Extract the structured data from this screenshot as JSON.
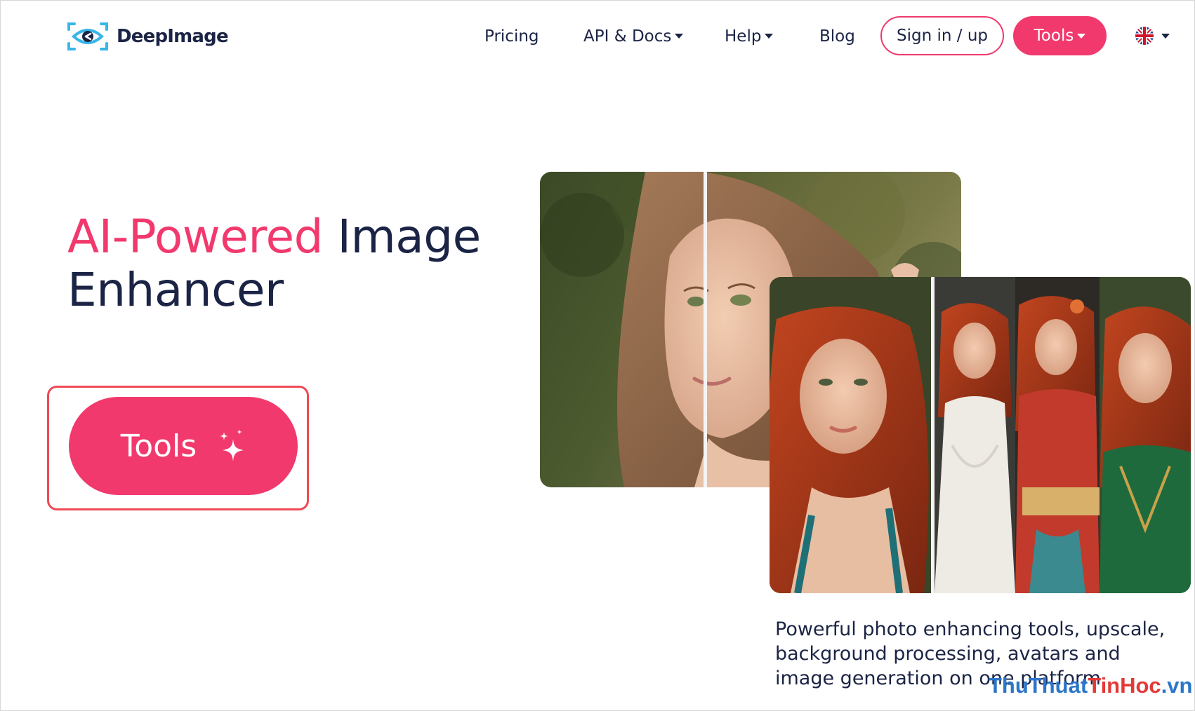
{
  "brand": {
    "name": "DeepImage",
    "colors": {
      "accent": "#f1396d",
      "logo_blue": "#38b6e8",
      "text": "#1b2445"
    }
  },
  "nav": {
    "pricing": "Pricing",
    "api_docs": "API & Docs",
    "help": "Help",
    "blog": "Blog",
    "sign_in": "Sign in / up",
    "tools": "Tools",
    "language_icon": "uk-flag-icon"
  },
  "hero": {
    "title_accent": "AI-Powered",
    "title_rest": "Image",
    "title_line2": "Enhancer",
    "tools_button": "Tools",
    "button_icon": "sparkle-icon",
    "description": "Powerful photo enhancing tools, upscale, background processing, avatars and image generation on one platform"
  },
  "watermark": {
    "blue_part": "ThuThuat",
    "red_part": "TinHoc",
    "suffix": ".vn"
  }
}
